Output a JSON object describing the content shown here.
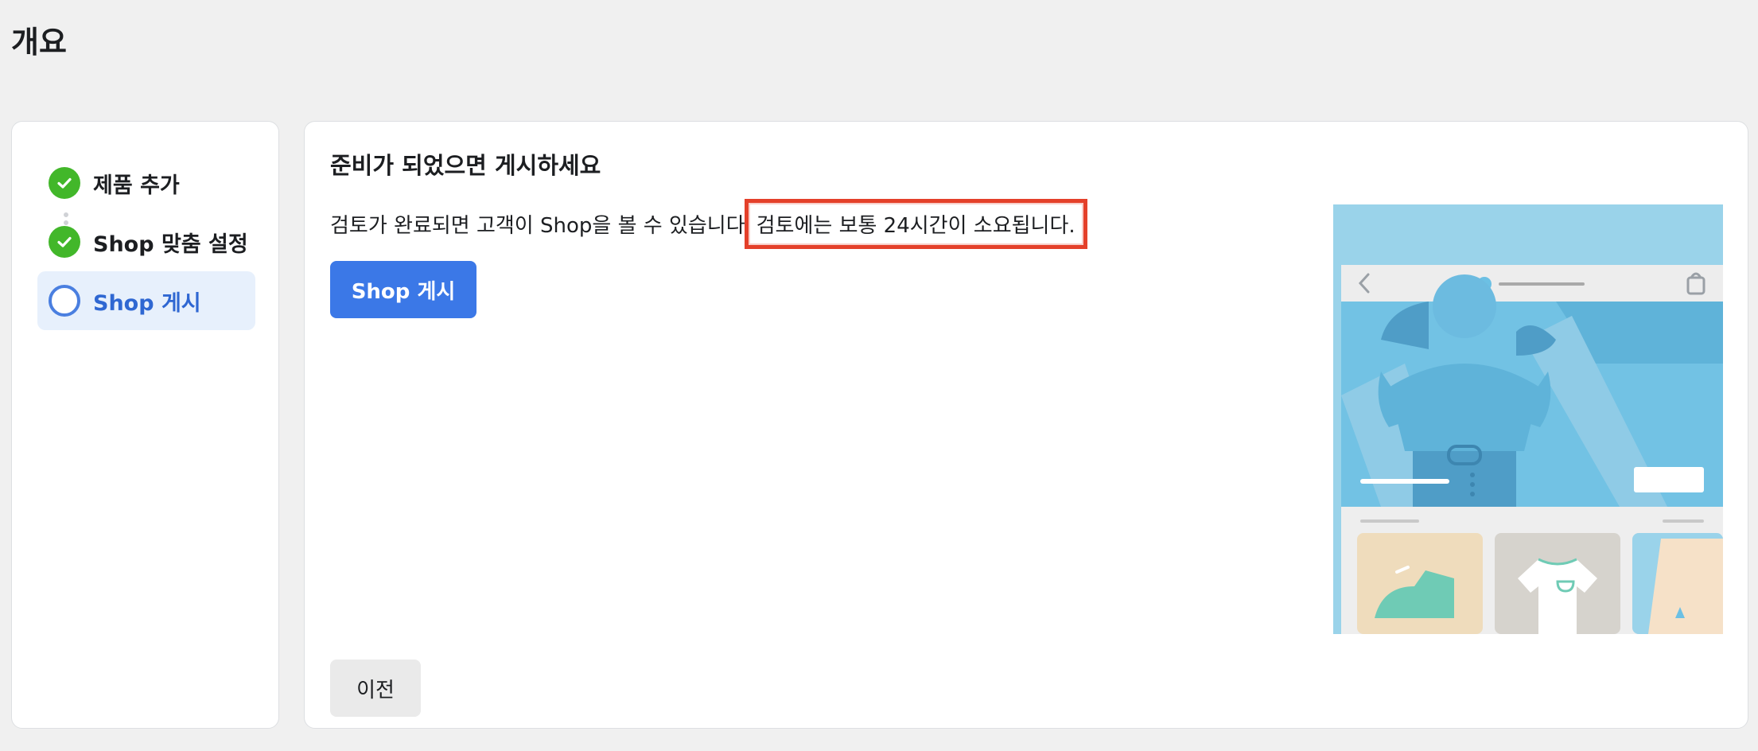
{
  "page": {
    "title": "개요"
  },
  "steps": [
    {
      "label": "제품 추가",
      "status": "done"
    },
    {
      "label": "Shop 맞춤 설정",
      "status": "done"
    },
    {
      "label": "Shop 게시",
      "status": "current"
    }
  ],
  "main": {
    "heading": "준비가 되었으면 게시하세요",
    "description": "검토가 완료되면 고객이 Shop을 볼 수 있습니다",
    "review_note": "검토에는 보통 24시간이 소요됩니다.",
    "publish_label": "Shop 게시",
    "prev_label": "이전"
  },
  "colors": {
    "accent": "#3b78e7",
    "done": "#42b72a",
    "highlight_border": "#e4402a",
    "illustration_sky": "#9ad3ea"
  },
  "icons": {
    "done": "check-circle-icon",
    "current": "circle-outline-icon",
    "back": "chevron-left-icon",
    "bag": "shopping-bag-icon"
  }
}
